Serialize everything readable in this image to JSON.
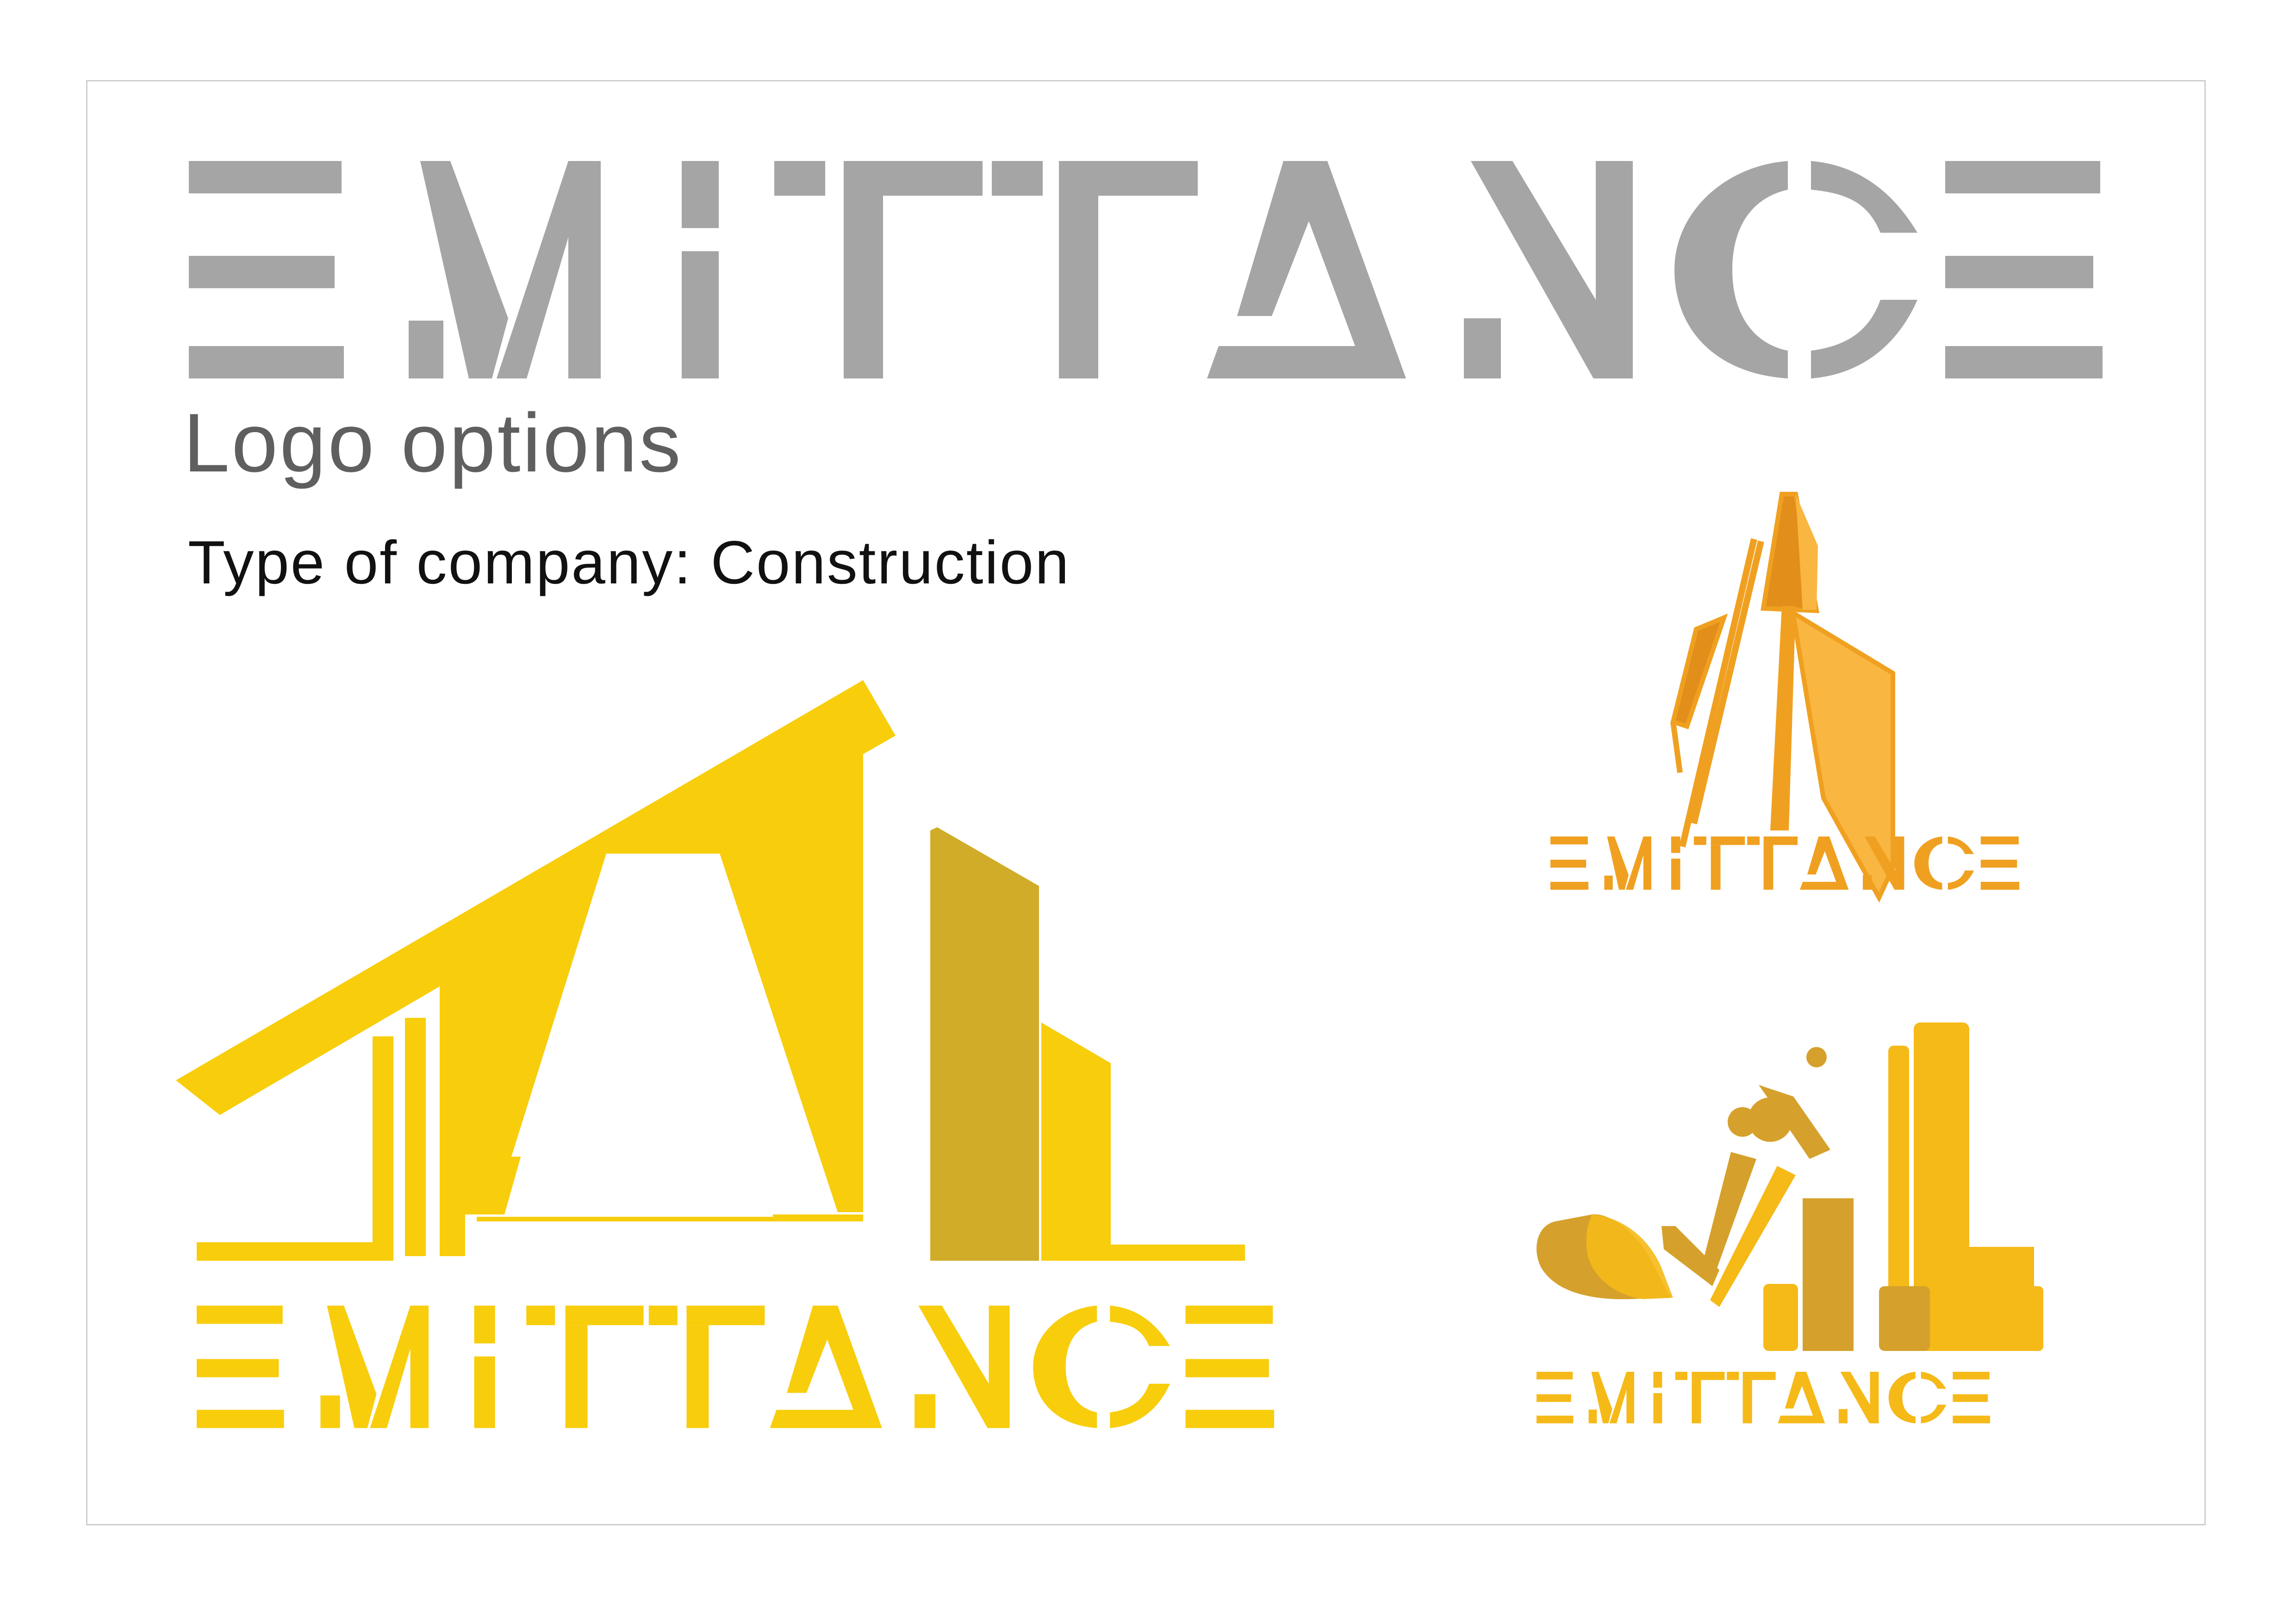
{
  "header": {
    "heading": "Logo options",
    "subheading": "Type of company: Construction"
  },
  "logos": [
    {
      "wordmark": "EMITTANCE",
      "style": "stencil-grey",
      "color": "#a5a5a5"
    },
    {
      "wordmark": "EMITTANCE",
      "style": "roof-and-buildings",
      "color": "#f8cd0c",
      "secondary": "#d1ac28"
    },
    {
      "wordmark": "EMITTANCE",
      "style": "tower-outline",
      "color": "#f0a020",
      "secondary": "#f9b640"
    },
    {
      "wordmark": "EMITTANCE",
      "style": "excavator-and-buildings",
      "color": "#f5b918",
      "secondary": "#d5a12c"
    }
  ],
  "colors": {
    "grey": "#a5a5a5",
    "yellow": "#f8cd0c",
    "mustard": "#d1ac28",
    "orange": "#f0a020",
    "amber": "#f5b918",
    "frame": "#cfcfcf"
  }
}
